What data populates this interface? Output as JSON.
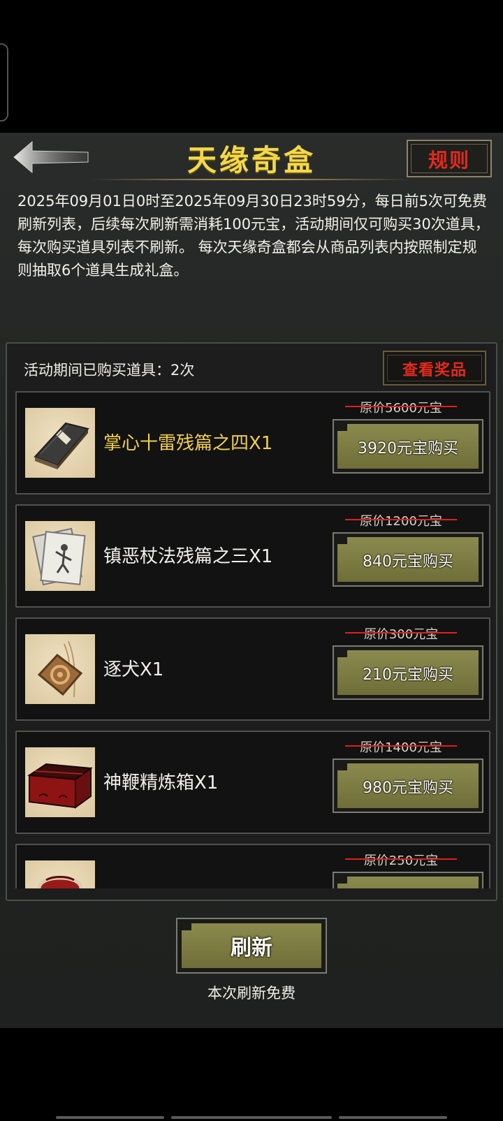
{
  "header": {
    "title": "天缘奇盒",
    "rules_label": "规则"
  },
  "description": "2025年09月01日0时至2025年09月30日23时59分，每日前5次可免费刷新列表，后续每次刷新需消耗100元宝，活动期间仅可购买30次道具，每次购买道具列表不刷新。 每次天缘奇盒都会从商品列表内按照制定规则抽取6个道具生成礼盒。",
  "shop": {
    "purchased_text": "活动期间已购买道具：2次",
    "view_prizes_label": "查看奖品",
    "items": [
      {
        "name": "掌心十雷残篇之四X1",
        "original_price": "原价5600元宝",
        "buy_label": "3920元宝购买",
        "icon": "book-icon"
      },
      {
        "name": "镇恶杖法残篇之三X1",
        "original_price": "原价1200元宝",
        "buy_label": "840元宝购买",
        "icon": "scroll-pages-icon"
      },
      {
        "name": "逐犬X1",
        "original_price": "原价300元宝",
        "buy_label": "210元宝购买",
        "icon": "talisman-icon"
      },
      {
        "name": "神鞭精炼箱X1",
        "original_price": "原价1400元宝",
        "buy_label": "980元宝购买",
        "icon": "red-chest-icon"
      },
      {
        "name": "",
        "original_price": "原价250元宝",
        "buy_label": "",
        "icon": "red-bag-icon"
      }
    ]
  },
  "footer": {
    "refresh_label": "刷新",
    "refresh_note": "本次刷新免费"
  },
  "colors": {
    "title_gold": "#f3d84a",
    "rules_red": "#e32a1d",
    "button_olive": "#7f7e44",
    "highlight_gold": "#f1cf50"
  }
}
